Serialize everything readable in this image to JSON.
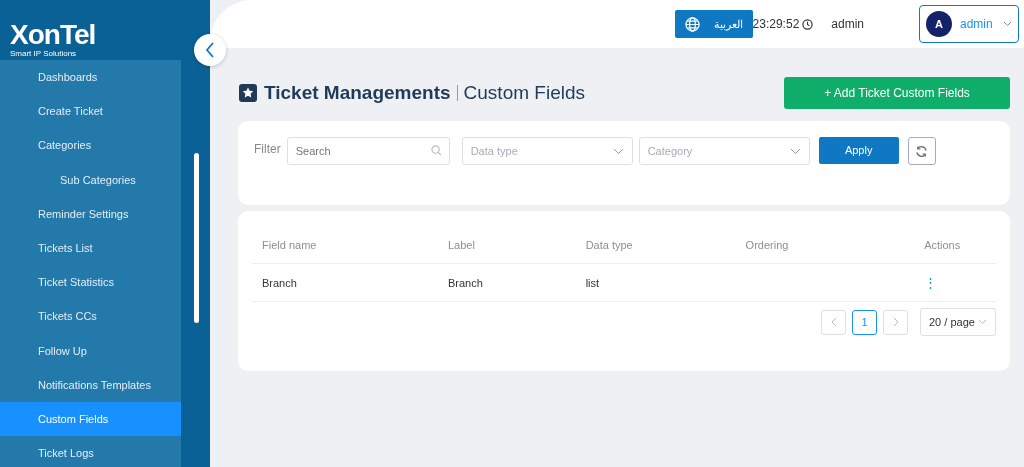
{
  "logo": {
    "name": "XonTel",
    "tagline": "Smart IP Solutions"
  },
  "sidebar": {
    "items": [
      {
        "label": "Dashboards",
        "selected": false
      },
      {
        "label": "Create Ticket",
        "selected": false
      },
      {
        "label": "Categories",
        "selected": false,
        "children": [
          {
            "label": "Sub Categories",
            "selected": false
          }
        ]
      },
      {
        "label": "Reminder Settings",
        "selected": false
      },
      {
        "label": "Tickets List",
        "selected": false
      },
      {
        "label": "Ticket Statistics",
        "selected": false
      },
      {
        "label": "Tickets CCs",
        "selected": false
      },
      {
        "label": "Follow Up",
        "selected": false
      },
      {
        "label": "Notifications Templates",
        "selected": false
      },
      {
        "label": "Custom Fields",
        "selected": true
      },
      {
        "label": "Ticket Logs",
        "selected": false
      }
    ]
  },
  "topbar": {
    "language_button": "العربية",
    "time": "23:29:52",
    "username": "admin",
    "user_menu": {
      "avatar": "A",
      "name": "admin"
    }
  },
  "page": {
    "title": "Ticket Managements",
    "subtitle": "Custom Fields",
    "add_button": "+ Add Ticket Custom Fields"
  },
  "filter": {
    "label": "Filter",
    "search_placeholder": "Search",
    "data_type_placeholder": "Data type",
    "category_placeholder": "Category",
    "apply_button": "Apply"
  },
  "table": {
    "columns": [
      "Field name",
      "Label",
      "Data type",
      "Ordering",
      "Actions"
    ],
    "rows": [
      {
        "field_name": "Branch",
        "label": "Branch",
        "data_type": "list",
        "ordering": "",
        "actions": "⋮"
      }
    ]
  },
  "pagination": {
    "pages": [
      {
        "label": "1",
        "selected": true
      }
    ],
    "page_size": "20 / page"
  }
}
